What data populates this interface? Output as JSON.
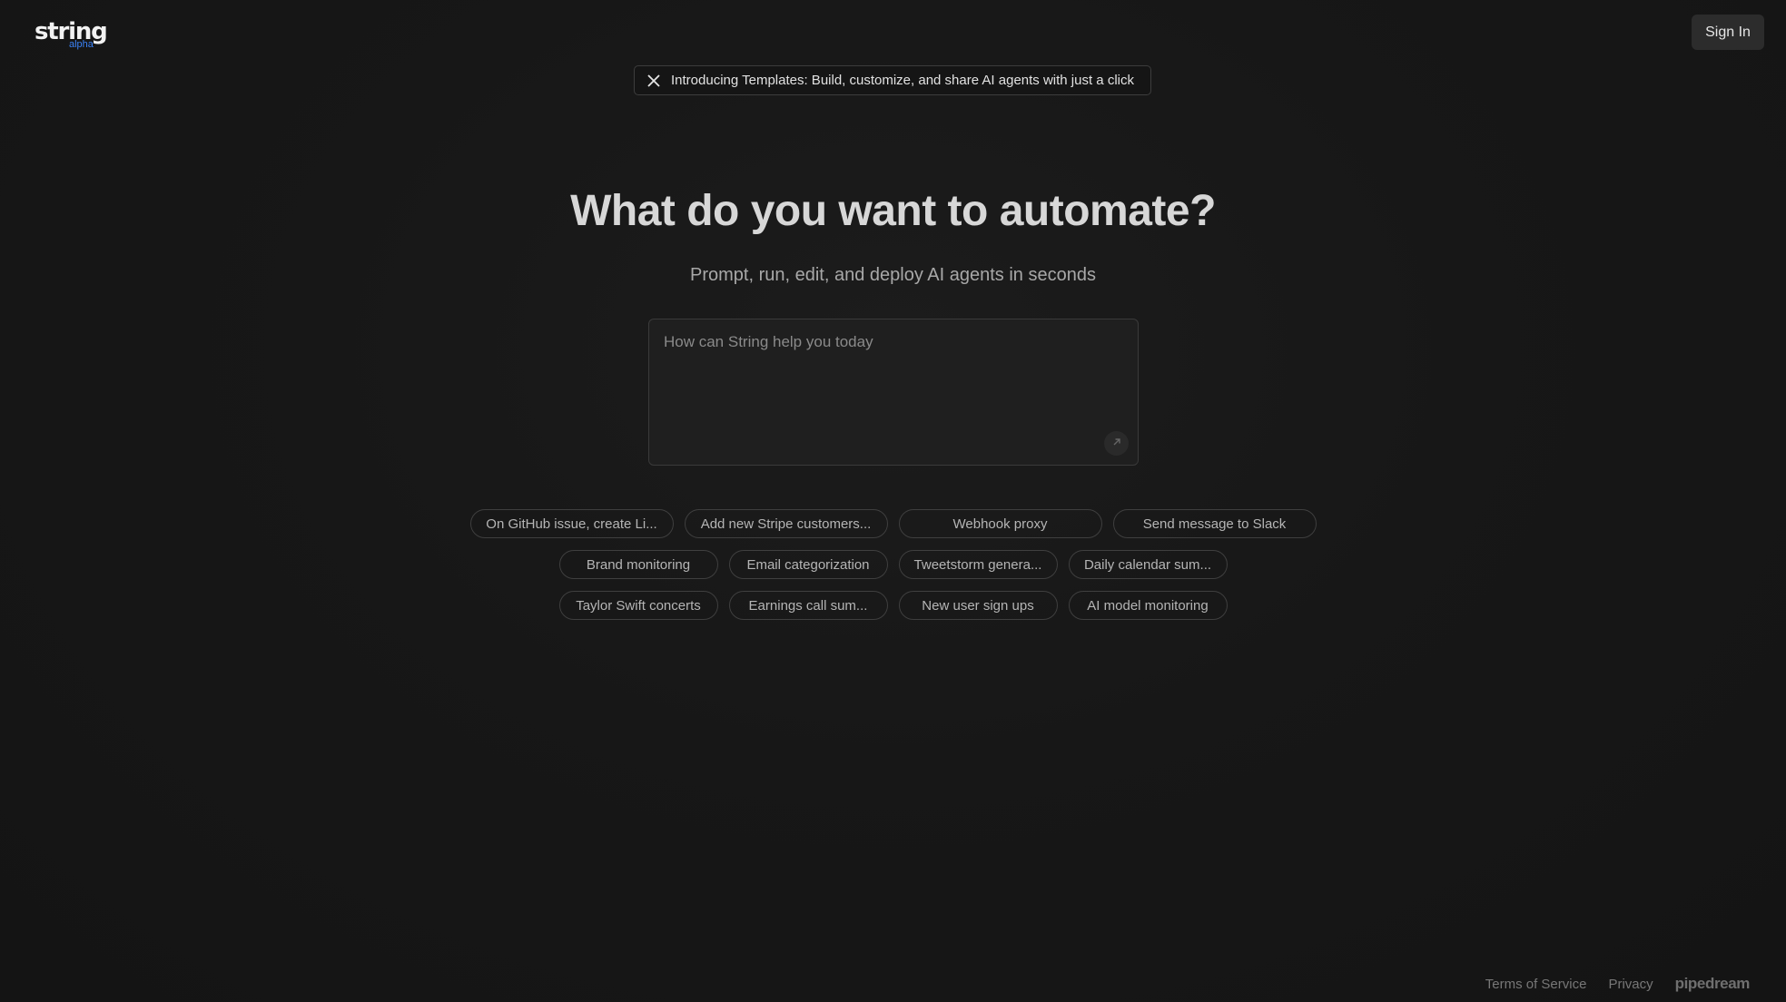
{
  "header": {
    "logo_text": "string",
    "logo_sub": "alpha",
    "signin_label": "Sign In"
  },
  "announcement": {
    "icon": "x-logo-icon",
    "text": "Introducing Templates: Build, customize, and share AI agents with just a click"
  },
  "hero": {
    "title": "What do you want to automate?",
    "subtitle": "Prompt, run, edit, and deploy AI agents in seconds"
  },
  "prompt": {
    "placeholder": "How can String help you today",
    "submit_icon": "arrow-up-right-icon"
  },
  "suggestions": {
    "row1": [
      "On GitHub issue, create Li...",
      "Add new Stripe customers...",
      "Webhook proxy",
      "Send message to Slack"
    ],
    "row2": [
      "Brand monitoring",
      "Email categorization",
      "Tweetstorm genera...",
      "Daily calendar sum..."
    ],
    "row3": [
      "Taylor Swift concerts",
      "Earnings call sum...",
      "New user sign ups",
      "AI model monitoring"
    ]
  },
  "footer": {
    "terms": "Terms of Service",
    "privacy": "Privacy",
    "brand": "pipedream"
  },
  "colors": {
    "background": "#161616",
    "accent": "#3b82f6",
    "button_bg": "#2c2c2c"
  }
}
